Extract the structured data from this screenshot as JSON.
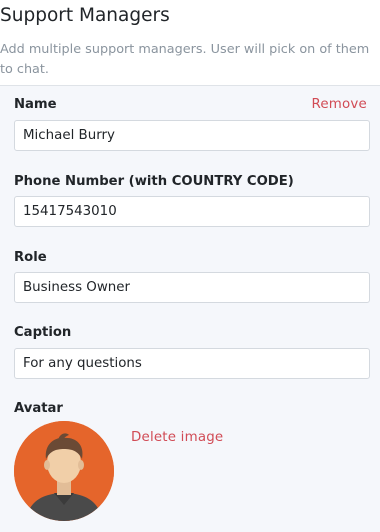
{
  "section": {
    "title": "Support Managers",
    "description": "Add multiple support managers. User will pick on of them to chat."
  },
  "manager": {
    "remove_label": "Remove",
    "name": {
      "label": "Name",
      "value": "Michael Burry"
    },
    "phone": {
      "label": "Phone Number (with COUNTRY CODE)",
      "value": "15417543010"
    },
    "role": {
      "label": "Role",
      "value": "Business Owner"
    },
    "caption": {
      "label": "Caption",
      "value": "For any questions"
    },
    "avatar": {
      "label": "Avatar",
      "delete_label": "Delete image",
      "icon": "person-avatar-image",
      "background_color": "#e5652b"
    }
  },
  "colors": {
    "danger": "#d14b55",
    "muted_text": "#8a949e",
    "card_background": "#f5f7fb"
  }
}
